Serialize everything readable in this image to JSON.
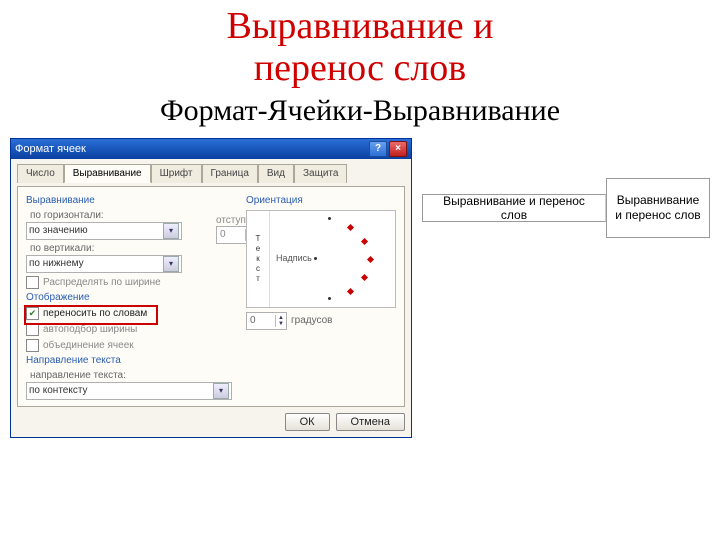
{
  "slide": {
    "title_line1": "Выравнивание и",
    "title_line2": "перенос слов",
    "subtitle": "Формат-Ячейки-Выравнивание"
  },
  "dialog": {
    "title": "Формат ячеек",
    "help": "?",
    "close": "×",
    "tabs": [
      "Число",
      "Выравнивание",
      "Шрифт",
      "Граница",
      "Вид",
      "Защита"
    ],
    "active_tab_index": 1,
    "group_align": "Выравнивание",
    "lbl_horiz": "по горизонтали:",
    "val_horiz": "по значению",
    "lbl_vert": "по вертикали:",
    "val_vert": "по нижнему",
    "lbl_indent": "отступ:",
    "val_indent": "0",
    "chk_distribute": "Распределять по ширине",
    "group_display": "Отображение",
    "chk_wrap": "переносить по словам",
    "chk_shrink": "автоподбор ширины",
    "chk_merge": "объединение ячеек",
    "group_direction": "Направление текста",
    "lbl_text_dir": "направление текста:",
    "val_text_dir": "по контексту",
    "group_orient": "Ориентация",
    "orient_vert_text": "Текст",
    "orient_inner": "Надпись",
    "val_degrees": "0",
    "lbl_degrees": "градусов",
    "btn_ok": "ОК",
    "btn_cancel": "Отмена"
  },
  "cells": {
    "nowrap": "Выравнивание и перенос слов",
    "wrap": "Выравнивание и перенос слов"
  }
}
